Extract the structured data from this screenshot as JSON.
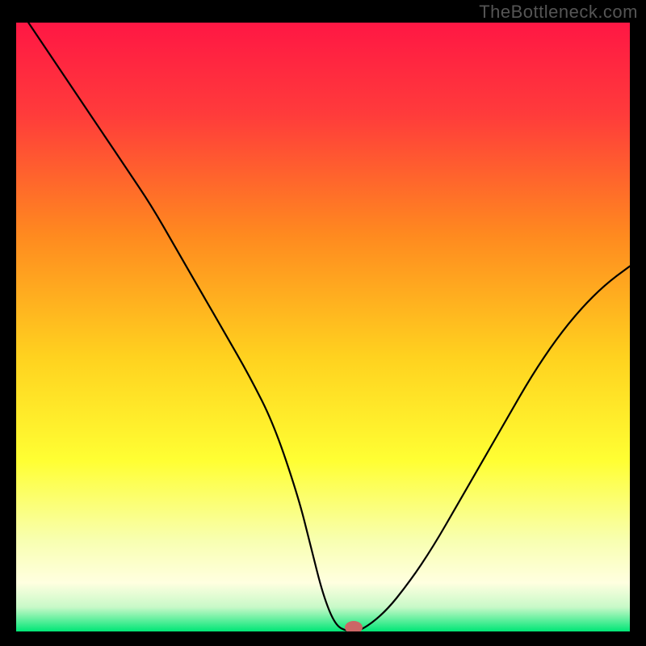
{
  "watermark": "TheBottleneck.com",
  "chart_data": {
    "type": "line",
    "title": "",
    "xlabel": "",
    "ylabel": "",
    "xlim": [
      0,
      100
    ],
    "ylim": [
      0,
      100
    ],
    "grid": false,
    "legend": false,
    "background_gradient": {
      "stops": [
        {
          "offset": 0.0,
          "color": "#ff1744"
        },
        {
          "offset": 0.15,
          "color": "#ff3b3b"
        },
        {
          "offset": 0.35,
          "color": "#ff8a1f"
        },
        {
          "offset": 0.55,
          "color": "#ffd21f"
        },
        {
          "offset": 0.72,
          "color": "#ffff33"
        },
        {
          "offset": 0.85,
          "color": "#f8ffb0"
        },
        {
          "offset": 0.92,
          "color": "#ffffe0"
        },
        {
          "offset": 0.96,
          "color": "#c8f9c8"
        },
        {
          "offset": 1.0,
          "color": "#00e676"
        }
      ]
    },
    "series": [
      {
        "name": "bottleneck-curve",
        "x": [
          2,
          6,
          10,
          14,
          18,
          22,
          26,
          30,
          34,
          38,
          42,
          46,
          48,
          50,
          52,
          54,
          56,
          60,
          64,
          68,
          72,
          76,
          80,
          84,
          88,
          92,
          96,
          100
        ],
        "y": [
          100,
          94,
          88,
          82,
          76,
          70,
          63,
          56,
          49,
          42,
          34,
          22,
          14,
          6,
          1,
          0,
          0,
          3,
          8,
          14,
          21,
          28,
          35,
          42,
          48,
          53,
          57,
          60
        ]
      }
    ],
    "marker": {
      "name": "optimal-point",
      "x": 55,
      "y": 0,
      "color": "#cc6666"
    }
  }
}
